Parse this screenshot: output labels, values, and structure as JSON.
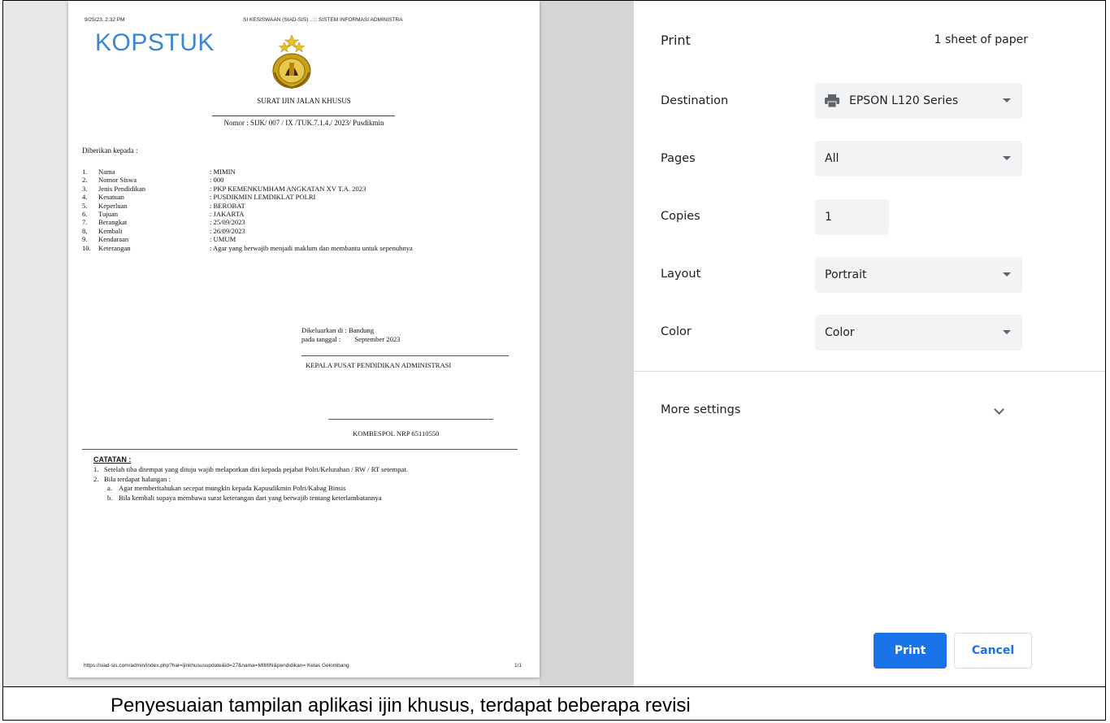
{
  "document": {
    "header_datetime": "9/25/23, 2:32 PM",
    "header_site": "SI KESISWAAN (SIAD-SIS) ..::: SISTEM INFORMASI ADMINISTRA",
    "kopstuk": "KOPSTUK",
    "title": "SURAT IJIN JALAN KHUSUS",
    "number": "Nomor : SIJK/ 007 / IX /TUK.7.1.4./ 2023/ Pusdikmin",
    "addressed_to": "Diberikan kepada :",
    "fields": [
      {
        "num": "1.",
        "label": "Nama",
        "value": ": MIMIN"
      },
      {
        "num": "2.",
        "label": "Nomor Siswa",
        "value": ": 000"
      },
      {
        "num": "3.",
        "label": "Jenis Pendidikan",
        "value": ": PKP KEMENKUMHAM ANGKATAN XV T.A. 2023"
      },
      {
        "num": "4.",
        "label": "Kesatuan",
        "value": ": PUSDIKMIN LEMDIKLAT POLRI"
      },
      {
        "num": "5.",
        "label": "Keperluan",
        "value": ": BEROBAT"
      },
      {
        "num": "6.",
        "label": "Tujuan",
        "value": ": JAKARTA"
      },
      {
        "num": "7.",
        "label": "Berangkat",
        "value": ": 25/09/2023"
      },
      {
        "num": "8,",
        "label": "Kembali",
        "value": ": 26/09/2023"
      },
      {
        "num": "9.",
        "label": "Kendaraan",
        "value": ": UMUM"
      },
      {
        "num": "10.",
        "label": "Keterangan",
        "value": ": Agar yang berwajib menjadi maklum dan membantu untuk sepenuhnya"
      }
    ],
    "issued_at": "Dikeluarkan di : Bandung",
    "issued_date": "pada tanggal :        September 2023",
    "kepala": "KEPALA PUSAT PENDIDIKAN ADMINISTRASI",
    "signatory": "KOMBESPOL NRP 65110550",
    "catatan_title": "CATATAN :",
    "note1_num": "1.",
    "note1": "Setelah tiba ditempat yang dituju wajib melaporkan diri kepada pejabat Polri/Kelurahan / RW / RT setempat.",
    "note2_num": "2.",
    "note2": "Bila terdapat halangan :",
    "note2a_num": "a.",
    "note2a": "Agar memberitahukan secepat mungkin kepada Kapusdikmin Polri/Kabag Binsis",
    "note2b_num": "b.",
    "note2b": "Bila kembali supaya membawa surat keterangan dari yang berwajib tentang keterlambatannya",
    "footer_url": "https://siad-sis.com/admin/index.php?hal=ijinkhususupdate&id=27&nama=MIMIN&pendidikan= Kelas Gelombang",
    "footer_page": "1/1"
  },
  "print_panel": {
    "heading": "Print",
    "sheets": "1 sheet of paper",
    "destination_label": "Destination",
    "destination_value": "EPSON L120 Series",
    "pages_label": "Pages",
    "pages_value": "All",
    "copies_label": "Copies",
    "copies_value": "1",
    "layout_label": "Layout",
    "layout_value": "Portrait",
    "color_label": "Color",
    "color_value": "Color",
    "more_settings": "More settings",
    "print_button": "Print",
    "cancel_button": "Cancel"
  },
  "caption": "Penyesuaian tampilan aplikasi ijin khusus, terdapat beberapa revisi",
  "colors": {
    "accent": "#1a73e8",
    "kopstuk": "#3a86d4",
    "emblem_gold": "#d4a017"
  }
}
